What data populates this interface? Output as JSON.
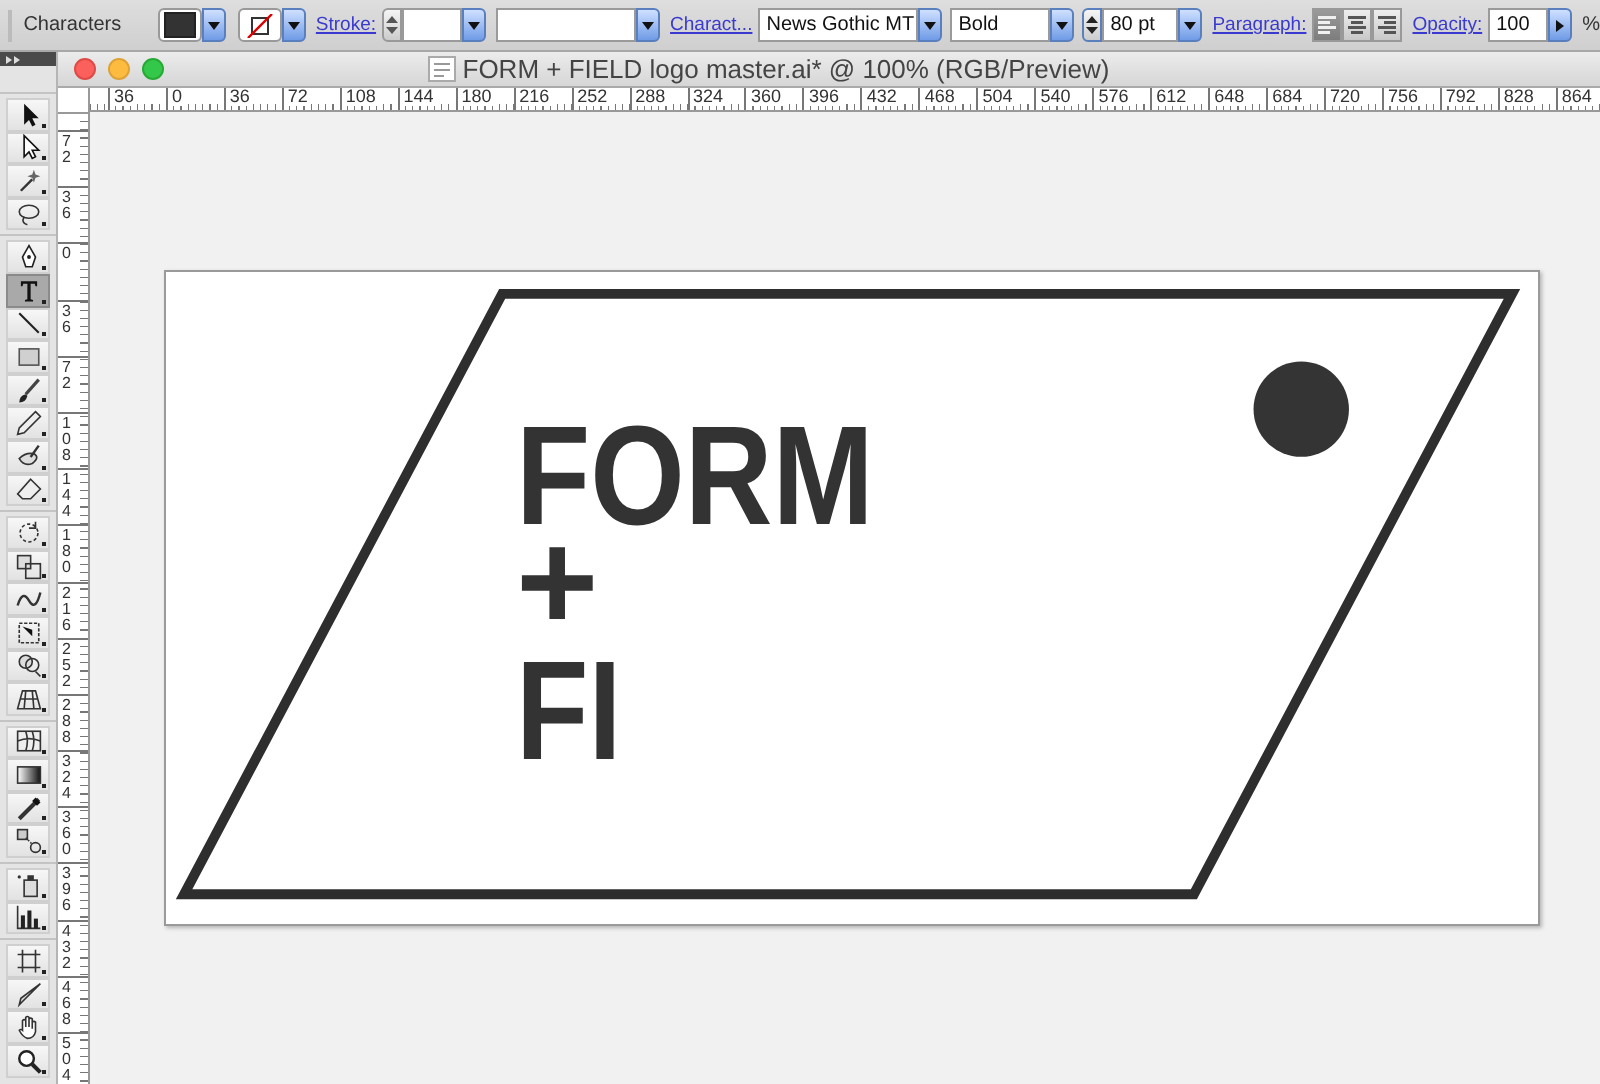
{
  "control_bar": {
    "panel_label": "Characters",
    "stroke_label": "Stroke:",
    "character_label": "Charact...",
    "font_family": "News Gothic MT",
    "font_style": "Bold",
    "font_size": "80 pt",
    "paragraph_label": "Paragraph:",
    "align_buttons": [
      {
        "kind": "left",
        "selected": true
      },
      {
        "kind": "center",
        "selected": false
      },
      {
        "kind": "right",
        "selected": false
      }
    ],
    "opacity_label": "Opacity:",
    "opacity": "100",
    "opacity_unit": "%"
  },
  "tool_groups": [
    {
      "tools": [
        {
          "kind": "selection",
          "selected": false
        },
        {
          "kind": "direct-selection",
          "selected": false
        },
        {
          "kind": "magic-wand",
          "selected": false
        },
        {
          "kind": "lasso",
          "selected": false
        }
      ]
    },
    {
      "tools": [
        {
          "kind": "pen",
          "selected": false
        },
        {
          "kind": "type",
          "selected": true
        },
        {
          "kind": "line",
          "selected": false
        },
        {
          "kind": "rectangle",
          "selected": false
        },
        {
          "kind": "paintbrush",
          "selected": false
        },
        {
          "kind": "pencil",
          "selected": false
        },
        {
          "kind": "blob-brush",
          "selected": false
        },
        {
          "kind": "eraser",
          "selected": false
        }
      ]
    },
    {
      "tools": [
        {
          "kind": "rotate",
          "selected": false
        },
        {
          "kind": "scale",
          "selected": false
        },
        {
          "kind": "warp",
          "selected": false
        },
        {
          "kind": "free-transform",
          "selected": false
        },
        {
          "kind": "shape-builder",
          "selected": false
        },
        {
          "kind": "perspective-grid",
          "selected": false
        }
      ]
    },
    {
      "tools": [
        {
          "kind": "mesh",
          "selected": false
        },
        {
          "kind": "gradient",
          "selected": false
        },
        {
          "kind": "eyedropper",
          "selected": false
        },
        {
          "kind": "blend",
          "selected": false
        }
      ]
    },
    {
      "tools": [
        {
          "kind": "symbol-sprayer",
          "selected": false
        },
        {
          "kind": "column-graph",
          "selected": false
        }
      ]
    },
    {
      "tools": [
        {
          "kind": "artboard",
          "selected": false
        },
        {
          "kind": "slice",
          "selected": false
        },
        {
          "kind": "hand",
          "selected": false
        },
        {
          "kind": "zoom",
          "selected": false
        }
      ]
    }
  ],
  "document": {
    "title": "FORM + FIELD logo master.ai* @ 100% (RGB/Preview)",
    "top_ruler": [
      "36",
      "0",
      "36",
      "72",
      "108",
      "144",
      "180",
      "216",
      "252",
      "288",
      "324",
      "360",
      "396",
      "432",
      "468",
      "504",
      "540",
      "576",
      "612",
      "648",
      "684",
      "720",
      "756",
      "792",
      "828",
      "864"
    ],
    "left_ruler": [
      "72",
      "36",
      "0",
      "36",
      "72",
      "108",
      "144",
      "180",
      "216",
      "252",
      "288",
      "324",
      "360",
      "396",
      "432",
      "468",
      "504"
    ],
    "artwork": {
      "lines": [
        "FORM",
        "+",
        "FI"
      ]
    }
  }
}
